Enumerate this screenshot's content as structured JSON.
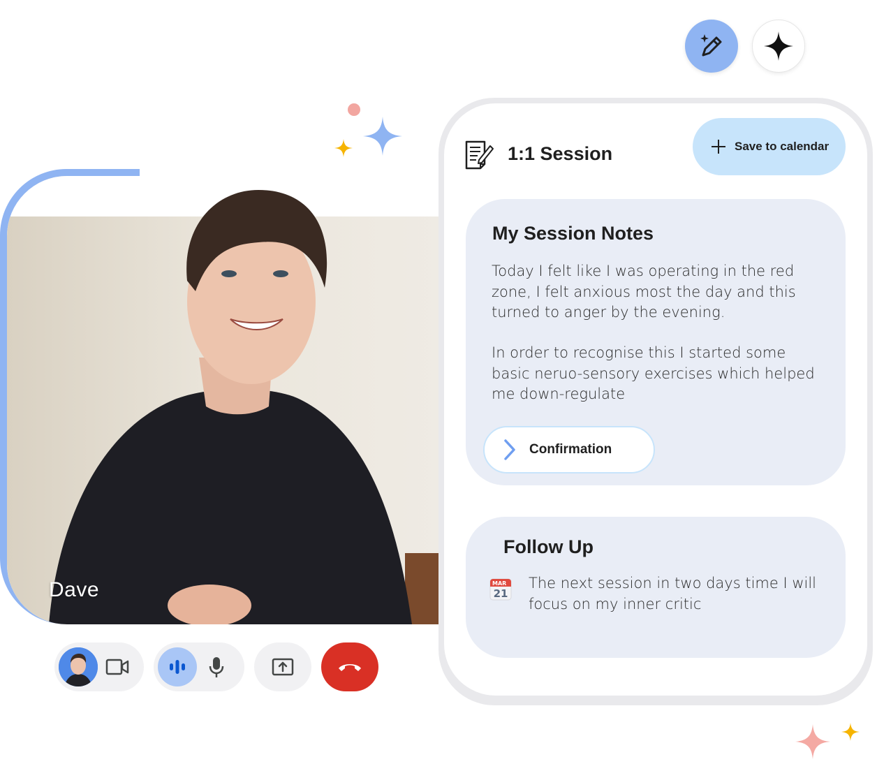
{
  "toolbar": {
    "magic_icon": "magic-pencil-icon",
    "sparkle_icon": "sparkle-icon"
  },
  "video": {
    "participant_name": "Dave"
  },
  "controls": {
    "camera_icon": "video-camera-icon",
    "voice_activity_icon": "audio-waveform-icon",
    "mic_icon": "microphone-icon",
    "share_icon": "present-screen-icon",
    "hangup_icon": "hang-up-icon",
    "hangup_color": "#d93025"
  },
  "session": {
    "title": "1:1 Session",
    "save_label": "Save to calendar",
    "notes": {
      "title": "My Session Notes",
      "paragraph_1": "Today I felt like I was operating in the red zone, I felt anxious most the day and this turned to anger by the evening.",
      "paragraph_2": "In order to recognise this I started some basic neruo-sensory exercises which helped me down-regulate",
      "confirm_label": "Confirmation"
    },
    "follow_up": {
      "title": "Follow Up",
      "calendar_month": "MAR",
      "calendar_day": "21",
      "text": "The next session in two days time I will focus on my inner critic"
    }
  },
  "colors": {
    "accent_blue": "#8fb4f2",
    "save_button": "#c7e4fb",
    "card_bg": "#e9edf6"
  }
}
